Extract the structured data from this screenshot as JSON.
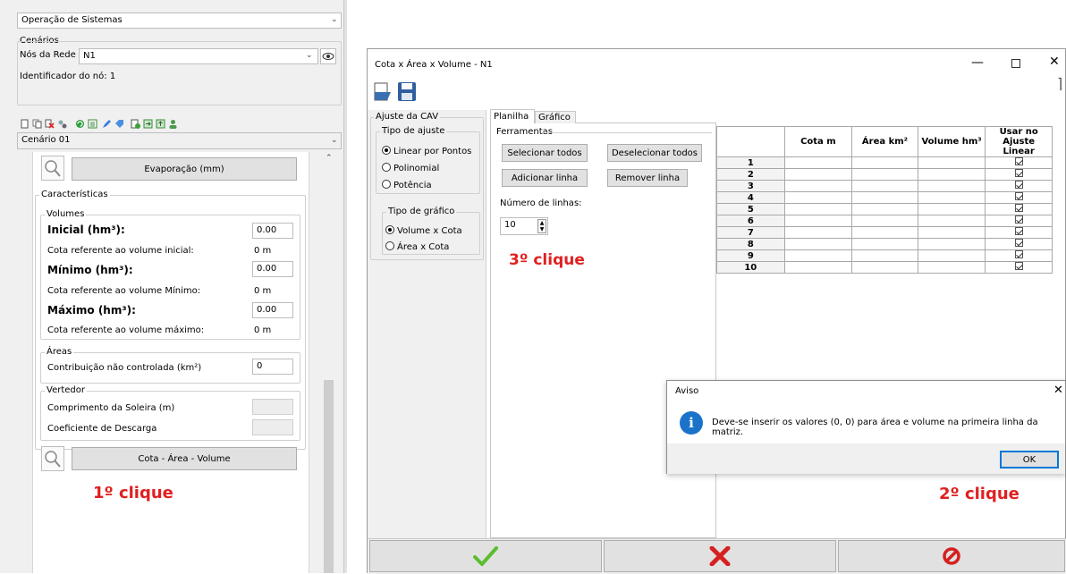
{
  "left": {
    "panel_title": "Operação de Sistemas",
    "cenarios_label": "Cenários",
    "nos_label": "Nós da Rede",
    "nos_value": "N1",
    "identificador": "Identificador do nó: 1",
    "cenario_value": "Cenário 01",
    "evaporacao_button": "Evaporação (mm)",
    "caracteristicas_label": "Características",
    "volumes_label": "Volumes",
    "inicial_label": "Inicial (hm³):",
    "inicial_value": "0.00",
    "cota_inicial_label": "Cota referente ao volume inicial:",
    "cota_inicial_value": "0 m",
    "minimo_label": "Mínimo (hm³):",
    "minimo_value": "0.00",
    "cota_minimo_label": "Cota referente ao volume Mínimo:",
    "cota_minimo_value": "0 m",
    "maximo_label": "Máximo (hm³):",
    "maximo_value": "0.00",
    "cota_maximo_label": "Cota referente ao volume máximo:",
    "cota_maximo_value": "0 m",
    "areas_label": "Áreas",
    "contribuicao_label": "Contribuição não controlada (km²)",
    "contribuicao_value": "0",
    "vertedor_label": "Vertedor",
    "comprimento_label": "Comprimento da Soleira (m)",
    "coeficiente_label": "Coeficiente de Descarga",
    "cav_button": "Cota - Área - Volume",
    "annotation": "1º clique"
  },
  "window": {
    "title": "Cota x Área x Volume - N1",
    "ajuste_cav": "Ajuste da CAV",
    "tipo_ajuste": "Tipo de ajuste",
    "ajuste_options": [
      "Linear por Pontos",
      "Polinomial",
      "Potência"
    ],
    "tipo_grafico": "Tipo de gráfico",
    "grafico_options": [
      "Volume x Cota",
      "Área x Cota"
    ],
    "tabs": [
      "Planilha",
      "Gráfico"
    ],
    "ferramentas": "Ferramentas",
    "selecionar_todos": "Selecionar todos",
    "deselecionar_todos": "Deselecionar todos",
    "adicionar_linha": "Adicionar linha",
    "remover_linha": "Remover linha",
    "numero_linhas_label": "Número de linhas:",
    "numero_linhas_value": "10",
    "annotation3": "3º clique",
    "table_headers": [
      "Cota m",
      "Área km²",
      "Volume hm³",
      "Usar no",
      "Ajuste Linear"
    ],
    "row_numbers": [
      "1",
      "2",
      "3",
      "4",
      "5",
      "6",
      "7",
      "8",
      "9",
      "10"
    ]
  },
  "dialog": {
    "title": "Aviso",
    "message": "Deve-se inserir os valores (0, 0) para área e volume na primeira linha da matriz.",
    "ok": "OK",
    "annotation2": "2º clique"
  },
  "colors": {
    "annotation": "#e02020",
    "info_icon": "#1a73c9",
    "ok_check": "#5cbd2e",
    "cancel_x": "#d62020"
  }
}
